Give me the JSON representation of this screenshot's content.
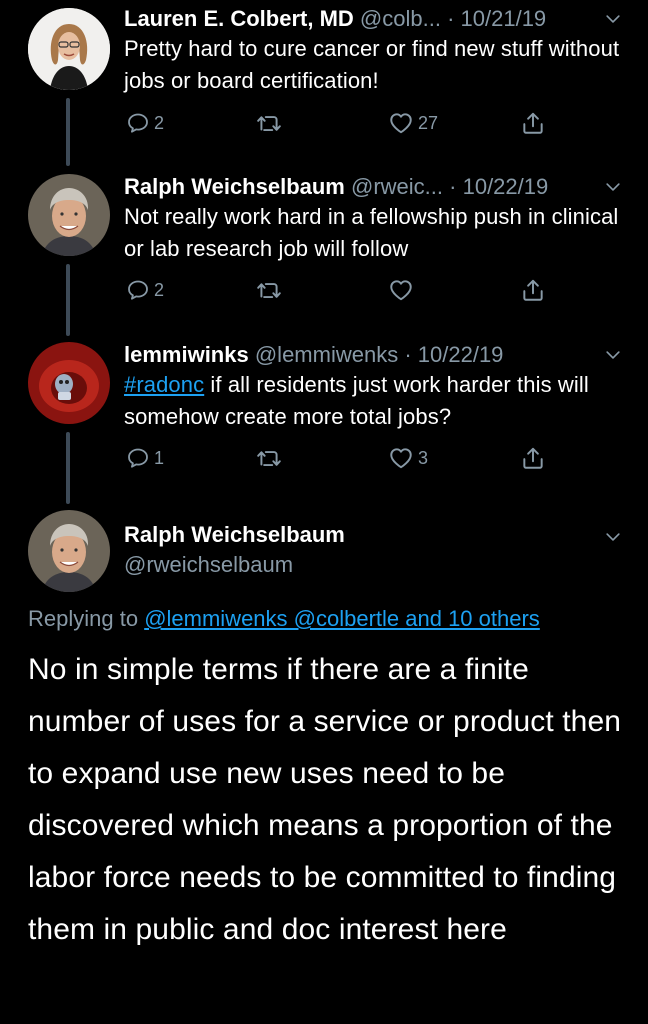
{
  "tweets": [
    {
      "name": "Lauren E. Colbert, MD",
      "handle": "@colb...",
      "date": "10/21/19",
      "text": "Pretty hard to cure cancer or find new stuff without jobs or board certification!",
      "replies": "2",
      "retweets": "",
      "likes": "27"
    },
    {
      "name": "Ralph Weichselbaum",
      "handle": "@rweic...",
      "date": "10/22/19",
      "text": "Not really work hard in a fellowship push in clinical or lab research job will follow",
      "replies": "2",
      "retweets": "",
      "likes": ""
    },
    {
      "name": "lemmiwinks",
      "handle": "@lemmiwenks",
      "date": "10/22/19",
      "hashtag": "#radonc",
      "text": " if all residents just work harder this will somehow create more total jobs?",
      "replies": "1",
      "retweets": "",
      "likes": "3"
    }
  ],
  "main_tweet": {
    "name": "Ralph Weichselbaum",
    "handle": "@rweichselbaum",
    "replying_prefix": "Replying to ",
    "replying_links": "@lemmiwenks @colbertle and 10 others",
    "text": "No in simple terms if there are a finite number of uses for a service or product then to expand use new uses need to be discovered which means a proportion of the labor force needs to be committed to finding them in public and doc interest here"
  },
  "separator": "·",
  "icons": {
    "reply": "reply-icon",
    "retweet": "retweet-icon",
    "like": "heart-icon",
    "share": "share-icon",
    "more": "chevron-down-icon"
  },
  "colors": {
    "background": "#000000",
    "secondary": "#8899a6",
    "link": "#1da1f2",
    "thread_line": "#3d4a57"
  }
}
